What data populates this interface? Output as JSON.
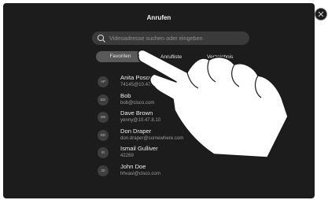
{
  "header": {
    "title": "Anrufen"
  },
  "search": {
    "placeholder": "Videoadresse suchen oder eingeben"
  },
  "tabs": [
    {
      "label": "Favoriten",
      "active": true
    },
    {
      "label": "Anrufliste",
      "active": false
    },
    {
      "label": "Verzeichnis",
      "active": false
    }
  ],
  "contacts": [
    {
      "initials": "AP",
      "name": "Anita Poscotti",
      "detail": "74145@10.47.8.10"
    },
    {
      "initials": "BO",
      "name": "Bob",
      "detail": "bob@cisco.com"
    },
    {
      "initials": "DB",
      "name": "Dave Brown",
      "detail": "yenny@10.47.8.10"
    },
    {
      "initials": "DD",
      "name": "Don Draper",
      "detail": "don.draper@somewhere.com"
    },
    {
      "initials": "IG",
      "name": "Ismail Gulliver",
      "detail": "42269"
    },
    {
      "initials": "JD",
      "name": "John Doe",
      "detail": "hhvasl@cisco.com"
    }
  ],
  "icons": {
    "search": "search-icon",
    "close": "close-icon",
    "hand": "pointing-hand-icon"
  },
  "colors": {
    "background": "#1c1c1c",
    "active_tab": "#595959",
    "text": "#ededed",
    "subtext": "#9c9c9c"
  }
}
